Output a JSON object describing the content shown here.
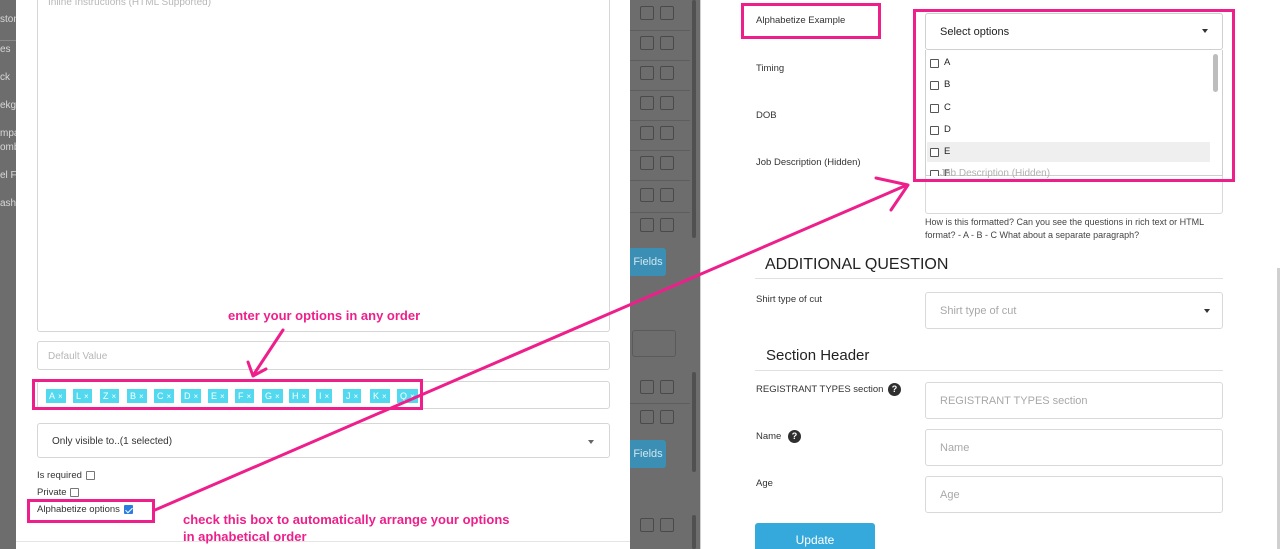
{
  "background_app": {
    "nav_items": [
      "stom",
      "es",
      "ck",
      "ekgr",
      "mpa",
      "omb",
      "el F",
      "ashbo"
    ],
    "fields_button_label": "Fields"
  },
  "modal": {
    "instructions_placeholder": "Inline Instructions (HTML Supported)",
    "default_value_placeholder": "Default Value",
    "options": [
      "A",
      "L",
      "Z",
      "B",
      "C",
      "D",
      "E",
      "F",
      "G",
      "H",
      "I",
      "J",
      "K",
      "Q"
    ],
    "tag_remove_glyph": "×",
    "visibility_select": "Only visible to..(1 selected)",
    "is_required_label": "Is required",
    "is_required_checked": false,
    "private_label": "Private",
    "private_checked": false,
    "alphabetize_label": "Alphabetize options",
    "alphabetize_checked": true
  },
  "annotations": {
    "enter_options": "enter your options in any order",
    "check_box_line1": "check this box to automatically arrange your options",
    "check_box_line2": "in aphabetical order",
    "color": "#ee1f8b"
  },
  "form": {
    "alphabetize_example_label": "Alphabetize Example",
    "select_placeholder": "Select options",
    "dropdown_options": [
      "A",
      "B",
      "C",
      "D",
      "E"
    ],
    "dropdown_partial_option": "F",
    "hovered_option": "E",
    "timing_label": "Timing",
    "dob_label": "DOB",
    "job_description_label": "Job Description (Hidden)",
    "job_description_placeholder": "Job Description (Hidden)",
    "job_help_text": "How is this formatted? Can you see the questions in rich text or HTML format? - A - B - C What about a separate paragraph?",
    "additional_question_heading": "ADDITIONAL QUESTION",
    "shirt_label": "Shirt type of cut",
    "shirt_placeholder": "Shirt type of cut",
    "section_header": "Section Header",
    "registrant_label": "REGISTRANT TYPES section",
    "registrant_placeholder": "REGISTRANT TYPES section",
    "name_label": "Name",
    "name_placeholder": "Name",
    "age_label": "Age",
    "age_placeholder": "Age",
    "update_button": "Update",
    "help_glyph": "?"
  },
  "colors": {
    "tag_bg": "#53d9ef",
    "update_button_bg": "#35a9dc",
    "dim_background": "#6d6d6d"
  }
}
